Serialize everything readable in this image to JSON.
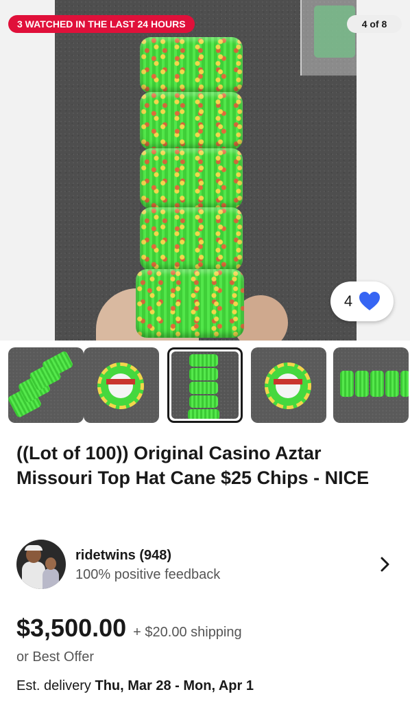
{
  "hero": {
    "watch_badge": "3 WATCHED IN THE LAST 24 HOURS",
    "image_counter": "4 of 8",
    "watch_count": "4",
    "icons": {
      "favorite": "heart-icon"
    },
    "colors": {
      "badge": "#e0103a",
      "heart": "#3665f3"
    }
  },
  "thumbnails": [
    {
      "name": "thumbnail-1",
      "selected": false
    },
    {
      "name": "thumbnail-2",
      "selected": false
    },
    {
      "name": "thumbnail-3",
      "selected": true
    },
    {
      "name": "thumbnail-4",
      "selected": false
    },
    {
      "name": "thumbnail-5",
      "selected": false
    }
  ],
  "listing": {
    "title": "((Lot of 100)) Original Casino Aztar Missouri Top Hat Cane $25 Chips - NICE"
  },
  "seller": {
    "name": "ridetwins (948)",
    "feedback": "100% positive feedback",
    "icons": {
      "open": "chevron-right-icon"
    }
  },
  "pricing": {
    "price": "$3,500.00",
    "shipping": "+ $20.00 shipping",
    "best_offer": "or Best Offer",
    "delivery_label": "Est. delivery ",
    "delivery_dates": "Thu, Mar 28 - Mon, Apr 1"
  }
}
